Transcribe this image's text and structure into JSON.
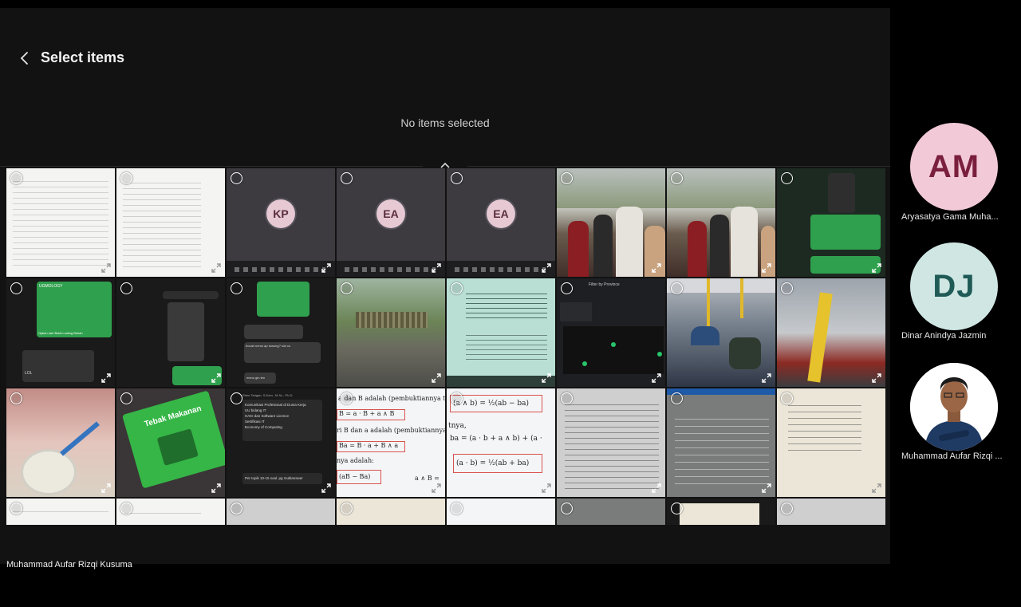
{
  "header": {
    "title": "Select items",
    "status": "No items selected"
  },
  "thumbs": {
    "avatar_initials": [
      "KP",
      "EA",
      "EA"
    ],
    "chat_green_1": "UGMOLOGY",
    "chat_green_2": "Ojalan dari Bukim saling Bekah",
    "chat_green_3": "LOL",
    "chat_dark_1": "bocah nemo ap kosong? sini cu",
    "chat_dark_2": "menu gin ten",
    "map_title": "Filter by Province",
    "app_title": "Tebak Makanan",
    "note_author": "Eben Tarigan, S.Kom., M.Sc., Ph.D.",
    "note_items": [
      "Komunikasi Profesional di Dunia Kerja",
      "UU bidang IT",
      "HAKI dan Software Licence",
      "Sertifikasi IT",
      "Economy of Computing"
    ],
    "note_reply": "Per topik 10-15 soal. pg multianswer",
    "math_1": "a dan B adalah (pembuktiannya t",
    "math_2": "B = a · B + a ∧ B",
    "math_3": "ri B dan a adalah (pembuktiannya",
    "math_4": "Ba = B · a + B ∧ a",
    "math_5": "nya adalah:",
    "math_6": "(aB − Ba)",
    "math_7": "a ∧ B =",
    "formula_1": "(a ∧ b) = ½(ab − ba)",
    "formula_2": "tnya,",
    "formula_3": "ba = (a · b + a ∧ b) + (a ·",
    "formula_4": "(a · b) = ½(ab + ba)"
  },
  "local_user_name": "Muhammad Aufar Rizqi Kusuma",
  "participants": [
    {
      "initials": "AM",
      "name": "Aryasatya Gama Muha...",
      "bg": "#f2c9d7",
      "fg": "#7a1f3d"
    },
    {
      "initials": "DJ",
      "name": "Dinar Anindya Jazmin",
      "bg": "#cfe6e3",
      "fg": "#1f5a56"
    },
    {
      "initials": "",
      "name": "Muhammad Aufar Rizqi ...",
      "bg": "#ffffff",
      "fg": "#000000"
    }
  ]
}
